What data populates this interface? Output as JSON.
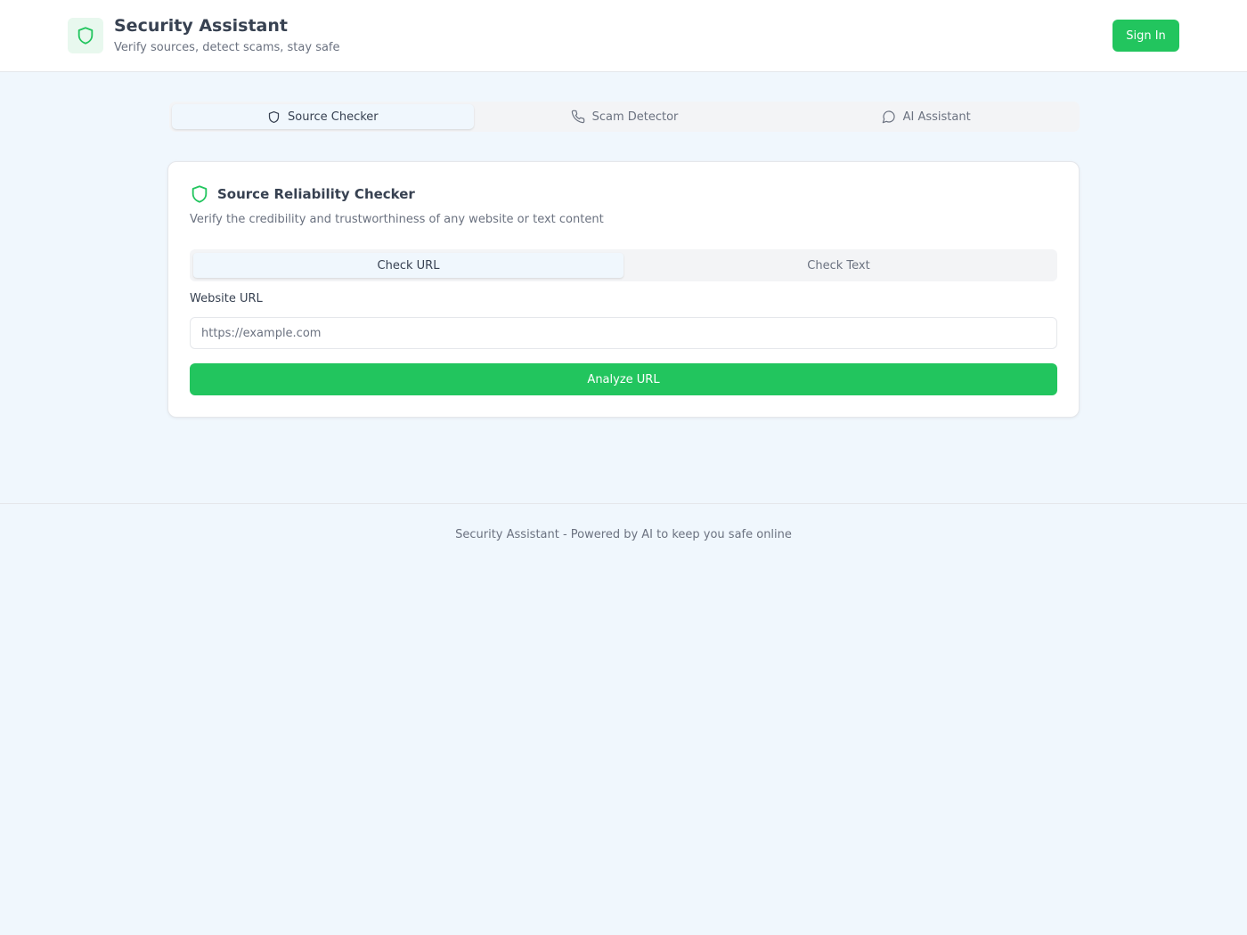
{
  "header": {
    "title": "Security Assistant",
    "subtitle": "Verify sources, detect scams, stay safe",
    "sign_in_label": "Sign In"
  },
  "main_tabs": [
    {
      "label": "Source Checker",
      "icon": "shield-icon",
      "active": true
    },
    {
      "label": "Scam Detector",
      "icon": "phone-icon",
      "active": false
    },
    {
      "label": "AI Assistant",
      "icon": "chat-bubble-icon",
      "active": false
    }
  ],
  "card": {
    "title": "Source Reliability Checker",
    "description": "Verify the credibility and trustworthiness of any website or text content",
    "sub_tabs": [
      {
        "label": "Check URL",
        "active": true
      },
      {
        "label": "Check Text",
        "active": false
      }
    ],
    "field_label": "Website URL",
    "input_value": "",
    "input_placeholder": "https://example.com",
    "analyze_label": "Analyze URL"
  },
  "footer": {
    "text": "Security Assistant - Powered by AI to keep you safe online"
  },
  "colors": {
    "accent": "#22c55e",
    "background": "#f0f7fd",
    "text": "#374151",
    "muted": "#6b7280"
  }
}
